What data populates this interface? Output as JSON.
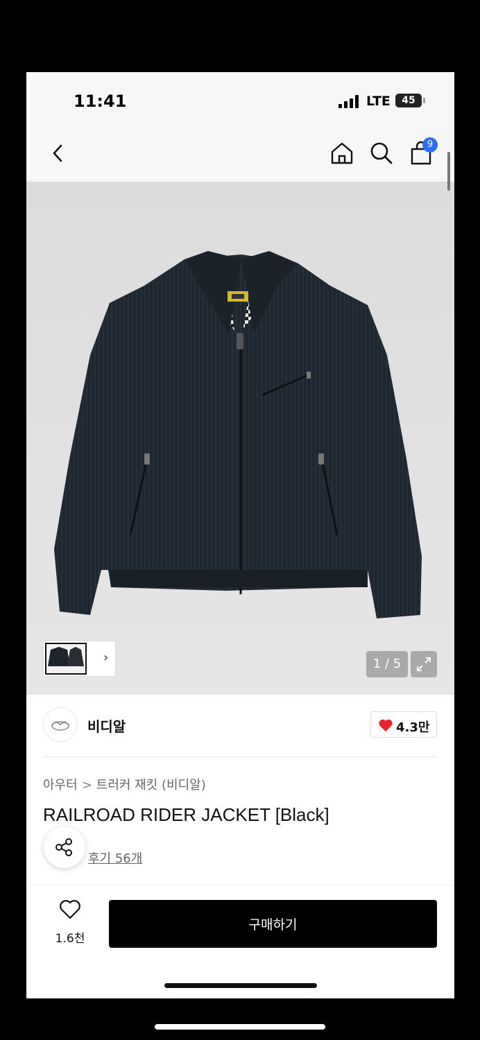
{
  "status_bar": {
    "time": "11:41",
    "network": "LTE",
    "battery": "45"
  },
  "nav": {
    "cart_count": "9"
  },
  "gallery": {
    "page_indicator": "1 / 5"
  },
  "brand": {
    "name": "비디알",
    "likes": "4.3만"
  },
  "product": {
    "breadcrumb": [
      "아우터",
      "트러커 재킷 (비디알)"
    ],
    "title": "RAILROAD RIDER JACKET [Black]",
    "reviews": "후기 56개"
  },
  "bottom": {
    "wish_count": "1.6천",
    "buy_label": "구매하기"
  },
  "colors": {
    "accent_blue": "#2b6ff2",
    "heart_red": "#e8242c",
    "button_black": "#000000"
  }
}
